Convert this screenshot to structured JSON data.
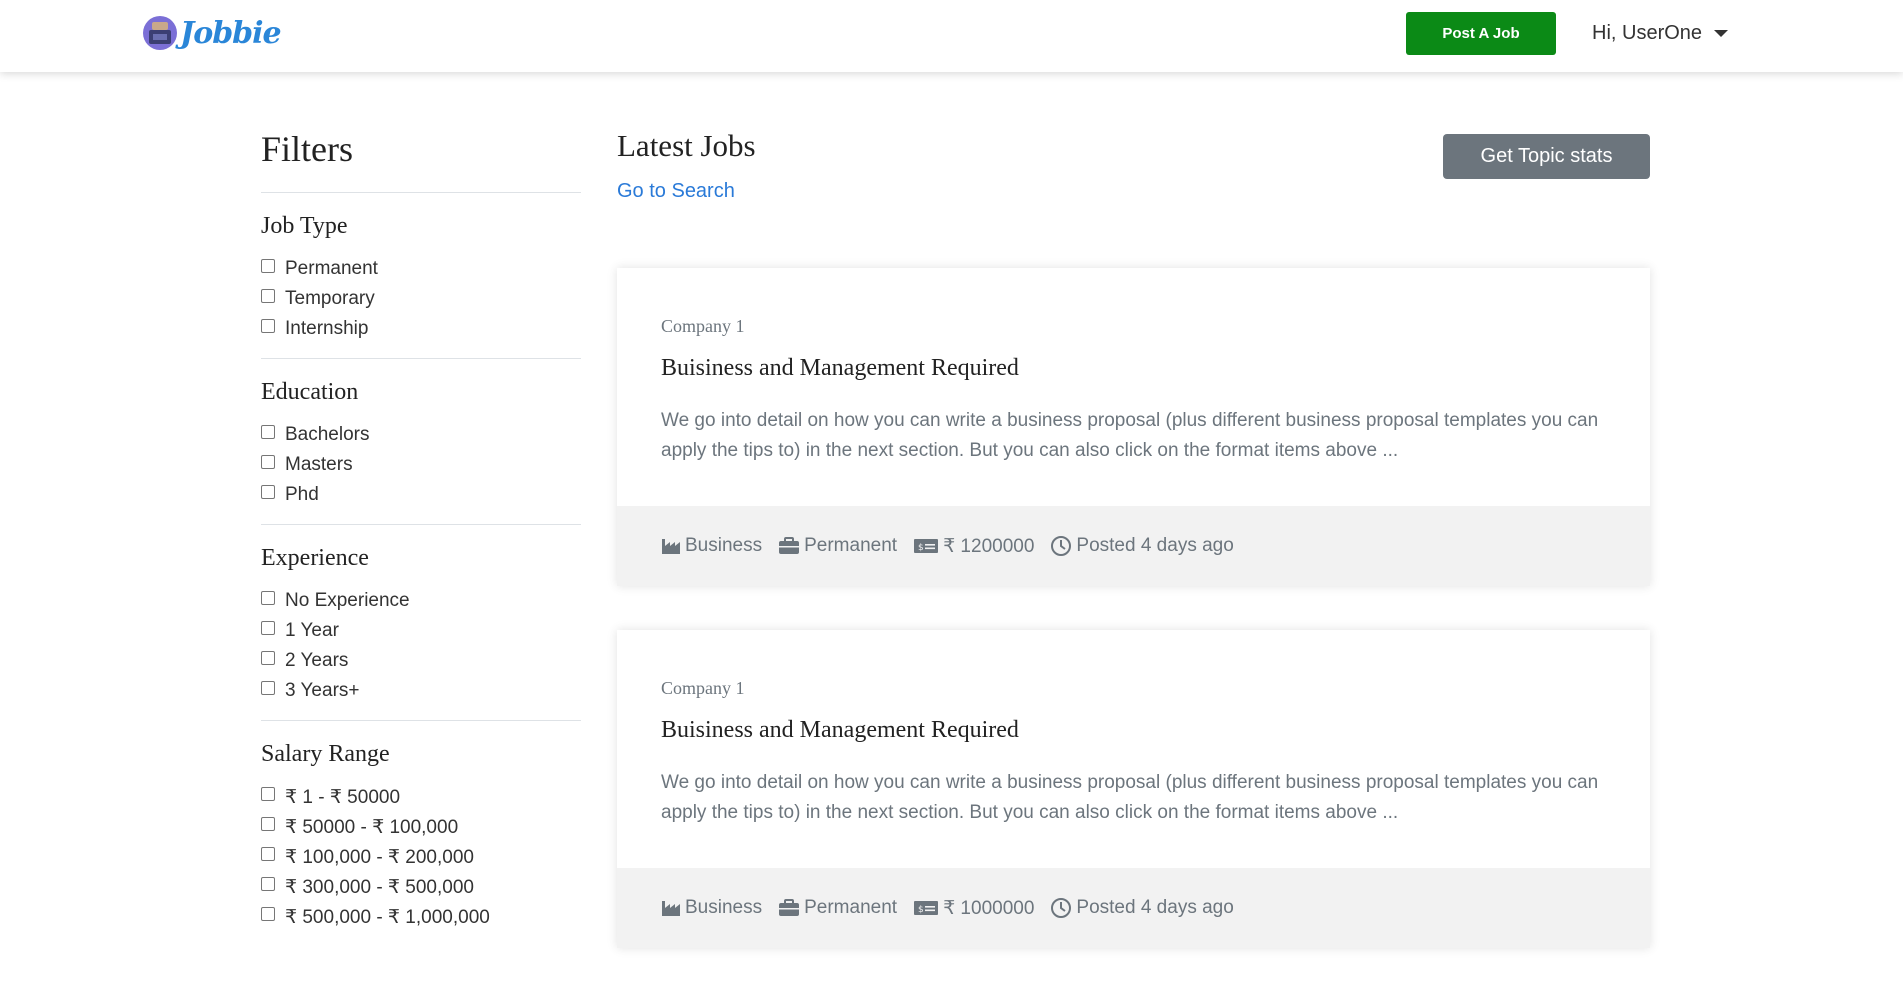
{
  "navbar": {
    "brand_name": "Jobbie",
    "post_button": "Post A Job",
    "user_greeting": "Hi, UserOne"
  },
  "sidebar": {
    "title": "Filters",
    "groups": [
      {
        "title": "Job Type",
        "options": [
          "Permanent",
          "Temporary",
          "Internship"
        ]
      },
      {
        "title": "Education",
        "options": [
          "Bachelors",
          "Masters",
          "Phd"
        ]
      },
      {
        "title": "Experience",
        "options": [
          "No Experience",
          "1 Year",
          "2 Years",
          "3 Years+"
        ]
      },
      {
        "title": "Salary Range",
        "options": [
          "₹ 1 -  ₹ 50000",
          "₹ 50000 -  ₹ 100,000",
          "₹ 100,000 -  ₹ 200,000",
          "₹ 300,000 -  ₹ 500,000",
          "₹ 500,000 -  ₹ 1,000,000"
        ]
      }
    ]
  },
  "main": {
    "title": "Latest Jobs",
    "search_link": "Go to Search",
    "topic_button": "Get Topic stats",
    "jobs": [
      {
        "company": "Company 1",
        "title": "Buisiness and Management Required",
        "description": "We go into detail on how you can write a business proposal (plus different business proposal templates you can apply the tips to) in the next section. But you can also click on the format items above ...",
        "industry": "Business",
        "job_type": "Permanent",
        "salary": "₹ 1200000",
        "posted": "Posted 4 days ago"
      },
      {
        "company": "Company 1",
        "title": "Buisiness and Management Required",
        "description": "We go into detail on how you can write a business proposal (plus different business proposal templates you can apply the tips to) in the next section. But you can also click on the format items above ...",
        "industry": "Business",
        "job_type": "Permanent",
        "salary": "₹ 1000000",
        "posted": "Posted 4 days ago"
      }
    ]
  },
  "colors": {
    "post_button": "#0b8a16",
    "topic_button": "#6c757d",
    "link": "#2a7ad8",
    "brand": "#2a86d8"
  }
}
